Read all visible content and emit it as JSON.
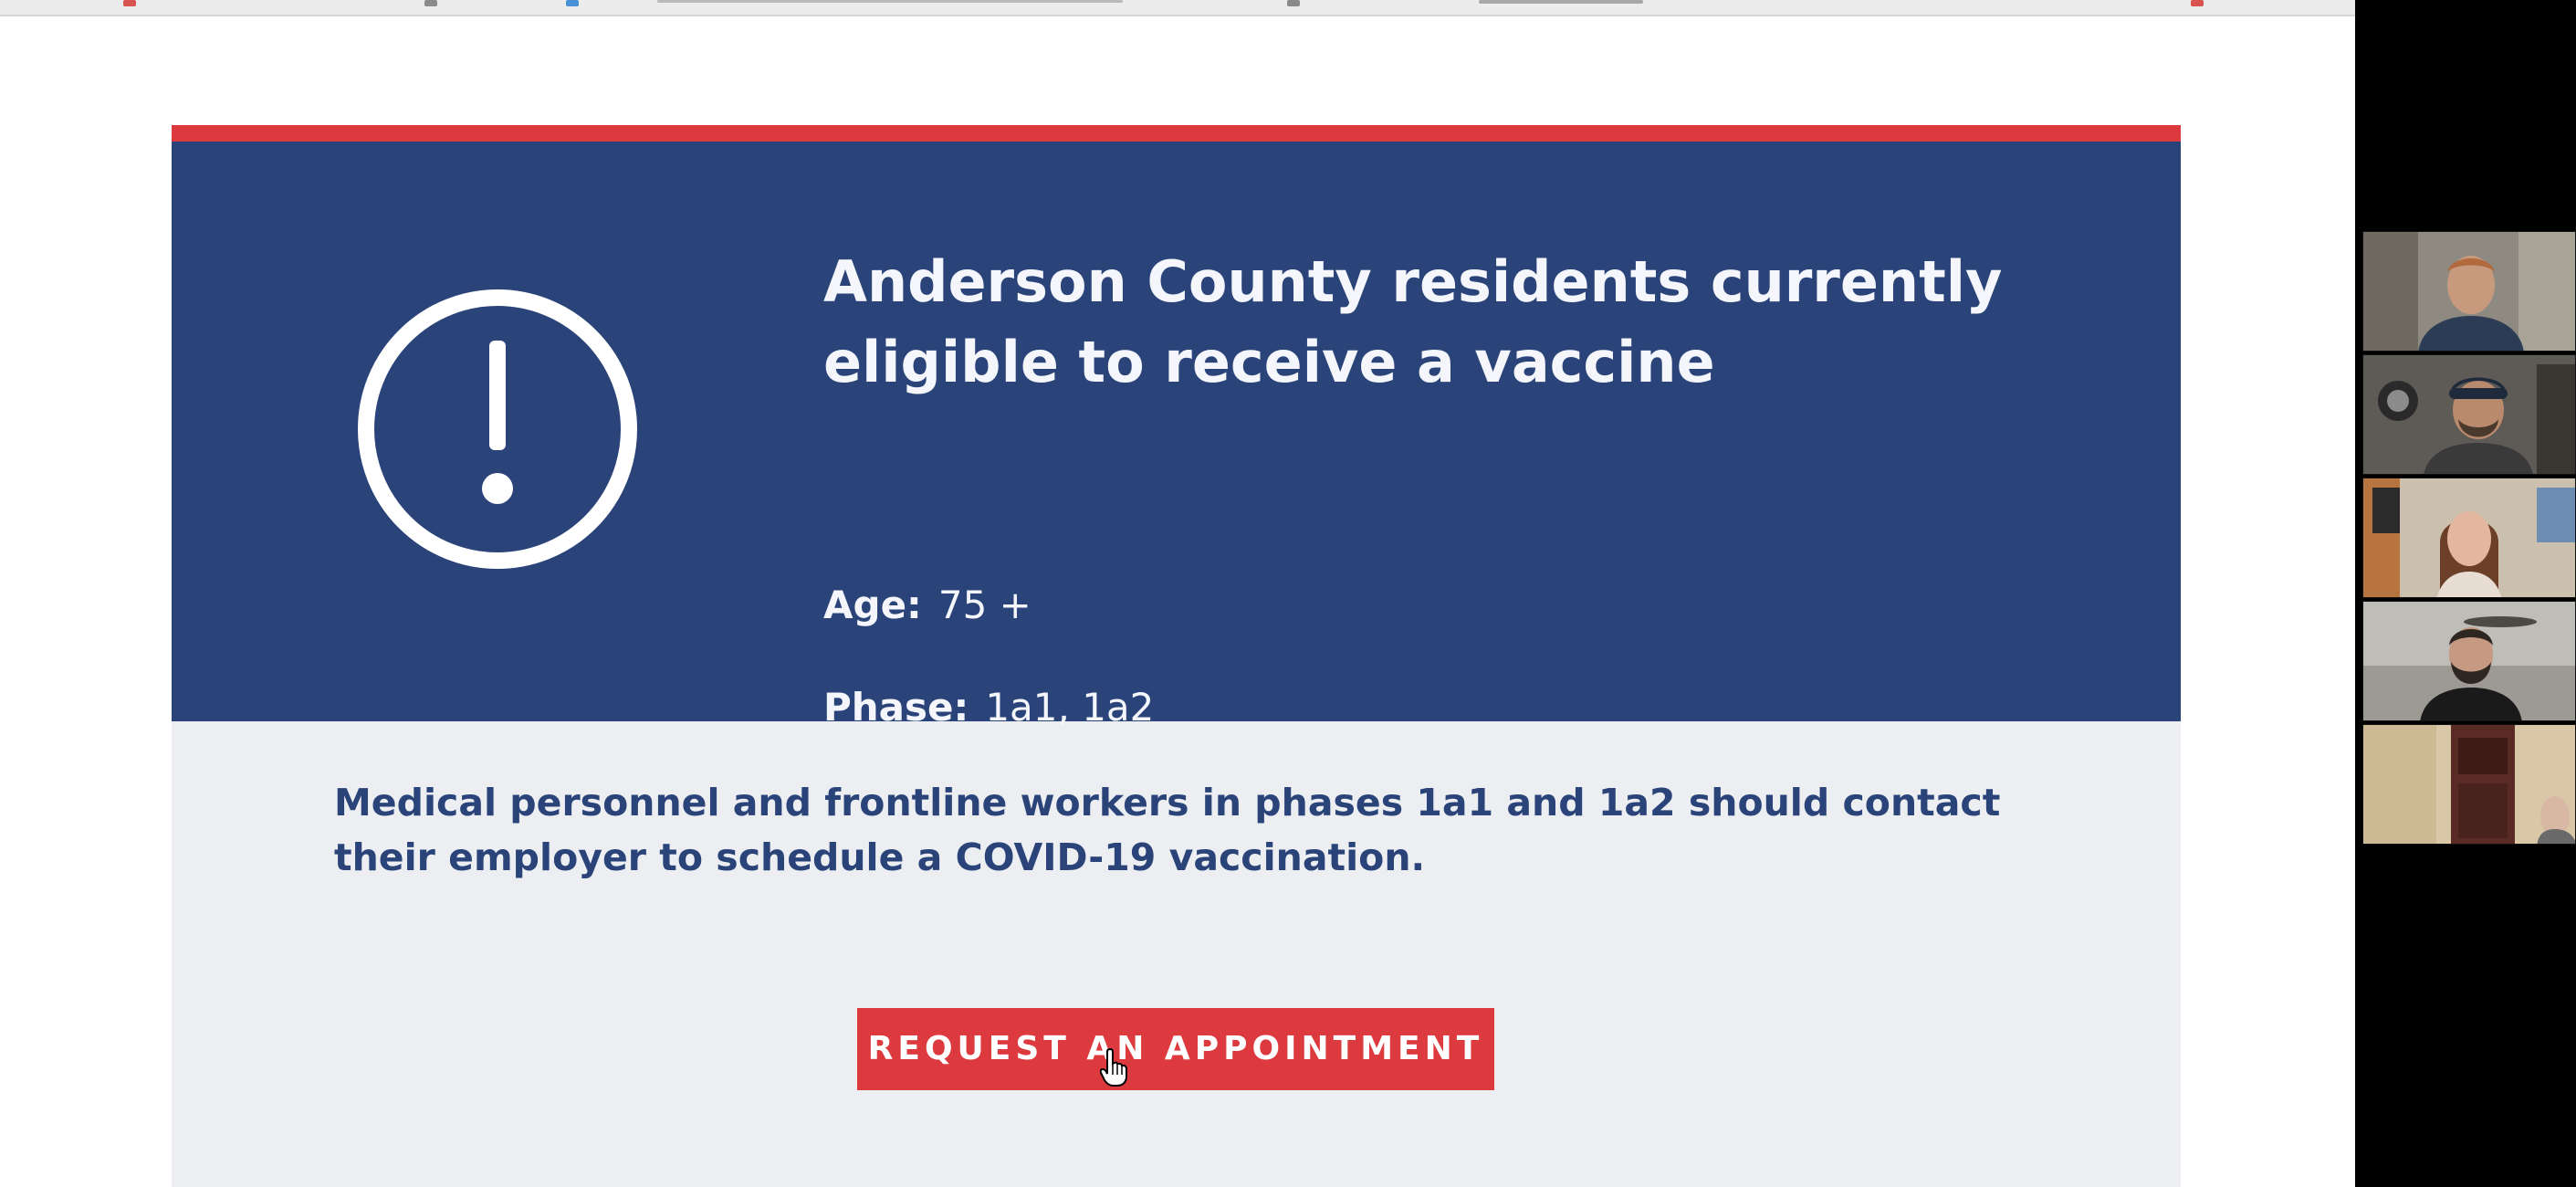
{
  "card": {
    "title": "Anderson County residents currently eligible to receive a vaccine",
    "age_label": "Age:",
    "age_value": "75 +",
    "phase_label": "Phase:",
    "phase_value": "1a1, 1a2",
    "message": "Medical personnel and frontline workers in phases 1a1 and 1a2  should contact their employer to schedule a  COVID-19 vaccination.",
    "cta_label": "REQUEST AN APPOINTMENT",
    "icon": "exclamation-circle-icon"
  },
  "colors": {
    "hero_background": "#2a447a",
    "accent_red": "#dc3a3e",
    "card_background": "#eceef1",
    "text_light": "#f4f6fb"
  },
  "gallery": {
    "participants": 5
  }
}
